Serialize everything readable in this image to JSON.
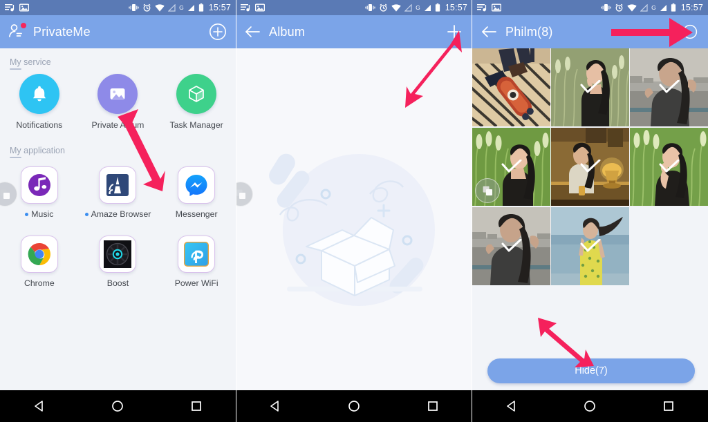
{
  "statusbar": {
    "time": "15:57",
    "left_icons": [
      "playlist-icon",
      "image-icon"
    ],
    "right_icons": [
      "vibrate-icon",
      "alarm-icon",
      "wifi-icon",
      "signal-empty-icon",
      "gprs-g-icon",
      "signal-full-icon",
      "battery-icon"
    ]
  },
  "colors": {
    "appbar": "#7ba4e8",
    "statusbar": "#5a7ab5",
    "page_bg": "#f2f4f8",
    "arrow": "#f5215c",
    "accent_text": "#44484f"
  },
  "panel1": {
    "appbar": {
      "title": "PrivateMe",
      "left_icon": "profile-icon",
      "right_icon": "plus-circle-icon"
    },
    "sections": [
      {
        "label": "My service",
        "items": [
          {
            "label": "Notifications",
            "icon": "bell-icon",
            "color": "#2ec4f3"
          },
          {
            "label": "Private Album",
            "icon": "photo-icon",
            "color": "#8e8ae8"
          },
          {
            "label": "Task Manager",
            "icon": "cube-icon",
            "color": "#3ed18b"
          }
        ]
      },
      {
        "label": "My application",
        "items": [
          {
            "label": "Music",
            "icon": "music-icon",
            "badge": true
          },
          {
            "label": "Amaze Browser",
            "icon": "amaze-icon",
            "badge": true
          },
          {
            "label": "Messenger",
            "icon": "messenger-icon",
            "badge": false
          },
          {
            "label": "Chrome",
            "icon": "chrome-icon",
            "badge": false
          },
          {
            "label": "Boost",
            "icon": "boost-icon",
            "badge": false
          },
          {
            "label": "Power WiFi",
            "icon": "power-wifi-icon",
            "badge": false
          }
        ]
      }
    ],
    "floating_bubble": "multi-window-bubble"
  },
  "panel2": {
    "appbar": {
      "title": "Album",
      "left_icon": "back-arrow-icon",
      "right_icon": "plus-icon"
    },
    "empty_state": "empty-box-illustration",
    "floating_bubble": "multi-window-bubble"
  },
  "panel3": {
    "appbar": {
      "title": "Philm(8)",
      "left_icon": "back-arrow-icon",
      "right_icon": "select-all-circle-icon"
    },
    "photos": [
      {
        "name": "skateboard-photo",
        "selected": false,
        "c1": "#e2c59a",
        "c2": "#3a3a44",
        "c3": "#c96b3c",
        "kind": "skate"
      },
      {
        "name": "grass-portrait-photo",
        "selected": true,
        "c1": "#8f9b6e",
        "c2": "#c9cfa8",
        "c3": "#2a2a26",
        "kind": "grass"
      },
      {
        "name": "riverside-portrait-photo",
        "selected": true,
        "c1": "#b7b5ae",
        "c2": "#8d8c88",
        "c3": "#3d3d3c",
        "kind": "river"
      },
      {
        "name": "grass-portrait-photo-2",
        "selected": true,
        "c1": "#79a04e",
        "c2": "#c2d79a",
        "c3": "#262421",
        "kind": "grass2"
      },
      {
        "name": "lamp-cafe-photo",
        "selected": true,
        "c1": "#a07a3b",
        "c2": "#e0b657",
        "c3": "#4a3a22",
        "kind": "cafe"
      },
      {
        "name": "grass-portrait-photo-3",
        "selected": true,
        "c1": "#7fa755",
        "c2": "#cfe0a6",
        "c3": "#2b2925",
        "kind": "grass3"
      },
      {
        "name": "riverside-portrait-photo-2",
        "selected": true,
        "c1": "#b6b4ad",
        "c2": "#8b8a86",
        "c3": "#3c3c3b",
        "kind": "river2"
      },
      {
        "name": "beach-yellow-dress-photo",
        "selected": true,
        "c1": "#a8c0cc",
        "c2": "#8fa9ba",
        "c3": "#e2d657",
        "kind": "beach"
      }
    ],
    "hide_button": "Hide(7)",
    "photo_bubble": "multi-window-bubble"
  },
  "navbar": {
    "back": "back-triangle-icon",
    "home": "home-circle-icon",
    "recents": "recents-square-icon"
  },
  "annotations": [
    {
      "name": "arrow-to-private-album"
    },
    {
      "name": "arrow-to-add-album"
    },
    {
      "name": "arrow-to-select-all"
    },
    {
      "name": "arrow-to-hide-button"
    }
  ]
}
